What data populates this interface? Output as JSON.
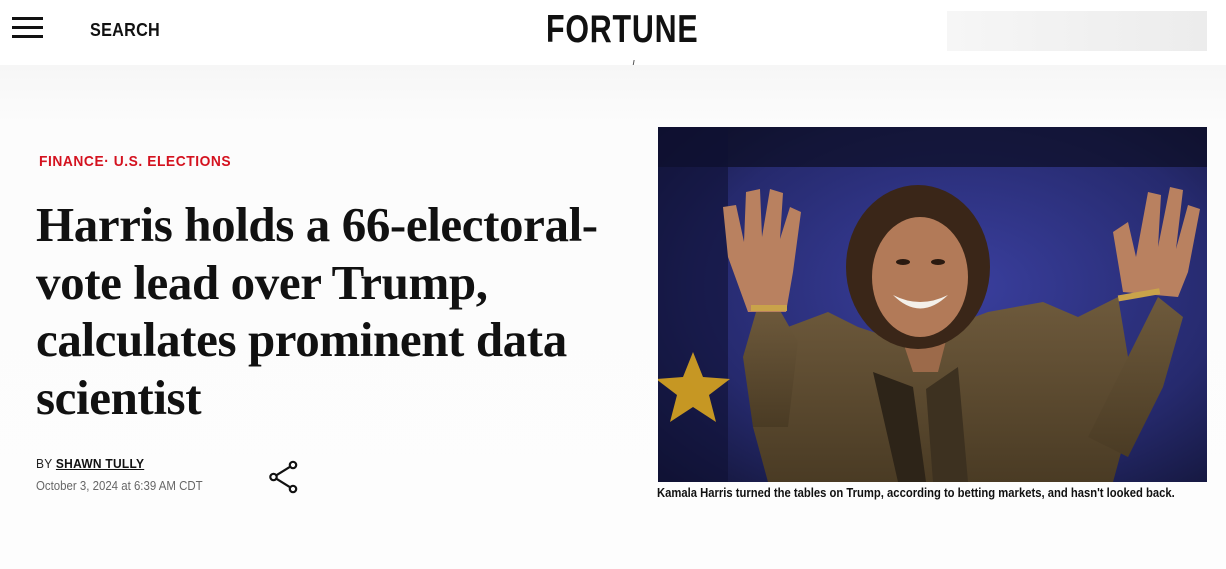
{
  "header": {
    "menu_icon": "hamburger-menu-icon",
    "search_label": "SEARCH",
    "logo_text": "FORTUNE"
  },
  "article": {
    "kicker": {
      "section": "FINANCE",
      "separator": "·",
      "subsection": "U.S. ELECTIONS"
    },
    "headline": "Harris holds a 66-electoral-vote lead over Trump, calculates prominent data scientist",
    "byline_prefix": "BY",
    "author": "SHAWN TULLY",
    "date": "October 3, 2024 at 6:39 AM CDT",
    "share_icon": "share-icon",
    "image_caption": "Kamala Harris turned the tables on Trump, according to betting markets, and hasn't looked back."
  },
  "colors": {
    "accent_red": "#d4121f",
    "text": "#111111",
    "muted": "#666666"
  }
}
